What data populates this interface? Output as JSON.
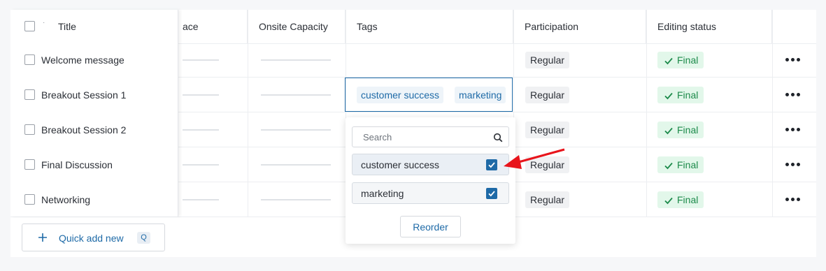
{
  "columns": {
    "title": "Title",
    "space_partial": "ace",
    "onsite_capacity": "Onsite Capacity",
    "tags": "Tags",
    "participation": "Participation",
    "editing_status": "Editing status"
  },
  "rows": [
    {
      "title": "Welcome message",
      "participation": "Regular",
      "status": "Final",
      "tags": []
    },
    {
      "title": "Breakout Session 1",
      "participation": "Regular",
      "status": "Final",
      "tags": [
        "customer success",
        "marketing"
      ]
    },
    {
      "title": "Breakout Session 2",
      "participation": "Regular",
      "status": "Final",
      "tags": []
    },
    {
      "title": "Final Discussion",
      "participation": "Regular",
      "status": "Final",
      "tags": []
    },
    {
      "title": "Networking",
      "participation": "Regular",
      "status": "Final",
      "tags": []
    }
  ],
  "tag_dropdown": {
    "search_placeholder": "Search",
    "options": [
      {
        "label": "customer success",
        "checked": true
      },
      {
        "label": "marketing",
        "checked": true
      }
    ],
    "reorder_label": "Reorder"
  },
  "quick_add": {
    "label": "Quick add new",
    "shortcut": "Q"
  },
  "colors": {
    "accent": "#1e6aa7",
    "final_bg": "#e2f7ea",
    "final_text": "#1c8a4a",
    "arrow": "#e8141b"
  },
  "icons": {
    "search": "search-icon",
    "check": "check-icon",
    "more": "more-horizontal-icon",
    "plus": "plus-icon"
  }
}
